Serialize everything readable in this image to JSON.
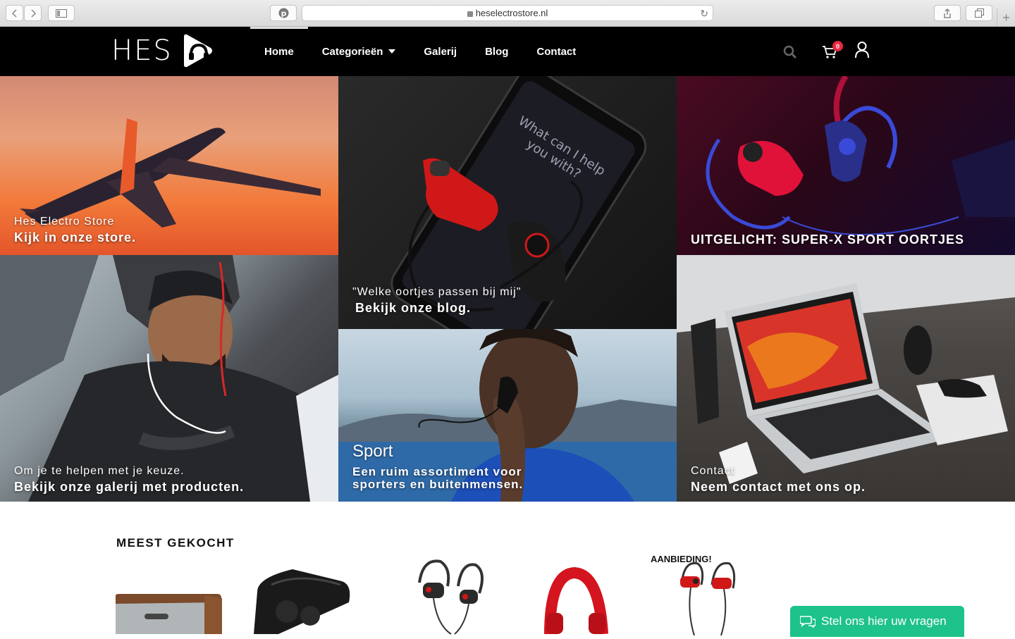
{
  "browser": {
    "url": "heselectrostore.nl",
    "new_tab": "+"
  },
  "header": {
    "logo_text": "HES",
    "nav": [
      {
        "label": "Home",
        "active": true
      },
      {
        "label": "Categorieën",
        "dropdown": true
      },
      {
        "label": "Galerij"
      },
      {
        "label": "Blog"
      },
      {
        "label": "Contact"
      }
    ],
    "cart_count": "0"
  },
  "hero": {
    "store": {
      "small": "Hes Electro Store",
      "big": "Kijk in onze store."
    },
    "blog": {
      "small": "\"Welke oortjes passen bij mij\"",
      "big": "Bekijk onze blog."
    },
    "featured": {
      "big": "UITGELICHT: SUPER-X SPORT OORTJES"
    },
    "gallery": {
      "small": "Om je te helpen met je keuze.",
      "big": "Bekijk onze galerij met producten."
    },
    "sport": {
      "title": "Sport",
      "text": "Een ruim assortiment voor sporters en buitenmensen."
    },
    "contact": {
      "small": "Contact",
      "big": "Neem contact met ons op."
    }
  },
  "most_bought": {
    "title": "MEEST GEKOCHT",
    "sale_label": "AANBIEDING!"
  },
  "chat": {
    "label": "Stel ons hier uw vragen"
  },
  "colors": {
    "accent": "#1ec28b",
    "badge": "#e8293f",
    "header_bg": "#000000"
  }
}
